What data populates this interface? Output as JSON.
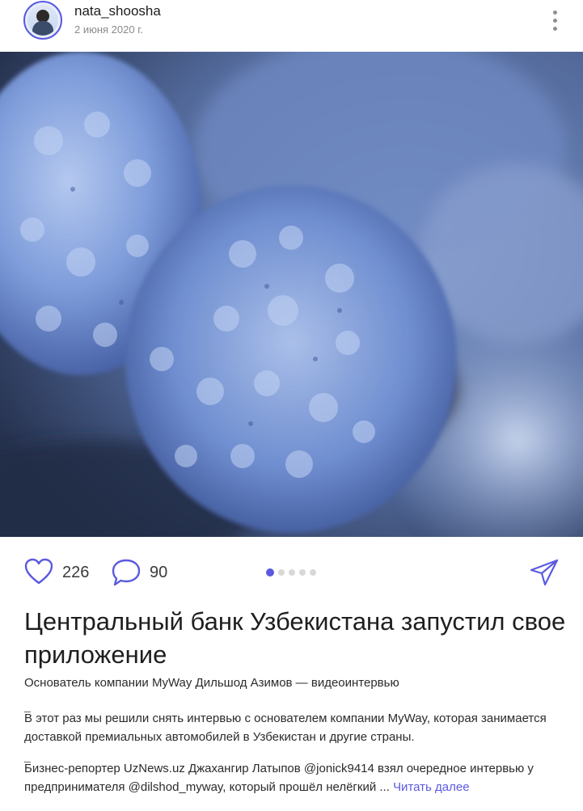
{
  "post": {
    "author": "nata_shoosha",
    "date": "2 июня 2020 г.",
    "likes": "226",
    "comments": "90",
    "carousel": {
      "total": 5,
      "active": 1
    },
    "title": "Центральный банк Узбекистана запустил свое приложение",
    "subtitle": "Основатель компании MyWay Дильшод Азимов — видеоинтервью",
    "separator": "_",
    "paragraph1": "В этот раз мы решили снять интервью с основателем компании MyWay, которая занимается доставкой премиальных автомобилей в Узбекистан и другие страны.",
    "paragraph2": "Бизнес-репортер UzNews.uz Джахангир Латыпов @jonick9414 взял очередное интервью у предпринимателя @dilshod_myway, который прошёл нелёгкий ...",
    "read_more": "Читать далее"
  },
  "icons": {
    "avatar": "avatar",
    "menu": "more-vertical-icon",
    "like": "heart-icon",
    "comment": "comment-bubble-icon",
    "share": "paper-plane-icon"
  },
  "colors": {
    "accent": "#5a5ae0",
    "icon": "#5a5ae0",
    "muted": "#8a8a8a"
  }
}
